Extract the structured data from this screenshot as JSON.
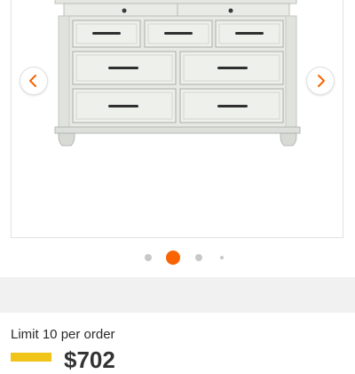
{
  "carousel": {
    "prev_icon": "chevron-left-icon",
    "next_icon": "chevron-right-icon",
    "dot_count": 4,
    "active_index": 1,
    "active_color": "#f96302",
    "inactive_color": "#c8c8c8"
  },
  "purchase": {
    "limit_text": "Limit 10 per order",
    "price_partial": "$702"
  },
  "colors": {
    "accent": "#f96302",
    "promo_badge": "#f0c419"
  }
}
